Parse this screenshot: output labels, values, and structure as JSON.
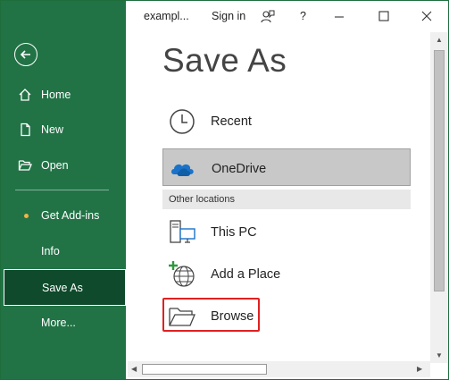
{
  "sidebar": {
    "back_icon": "back-arrow-icon",
    "items": [
      {
        "label": "Home",
        "icon": "home-icon"
      },
      {
        "label": "New",
        "icon": "new-document-icon"
      },
      {
        "label": "Open",
        "icon": "open-folder-icon"
      },
      {
        "label": "Get Add-ins",
        "icon": "dot-icon"
      },
      {
        "label": "Info"
      },
      {
        "label": "Save As",
        "selected": true
      },
      {
        "label": "More..."
      }
    ],
    "colors": {
      "background": "#217346",
      "selected": "#0e4a2b",
      "dot": "#f0b347"
    }
  },
  "titlebar": {
    "filename": "exampl...",
    "sign_in": "Sign in",
    "icons": [
      "people-help-icon",
      "help-icon",
      "minimize-icon",
      "maximize-icon",
      "close-icon"
    ],
    "help": "?"
  },
  "main": {
    "title": "Save As",
    "locations": [
      {
        "label": "Recent",
        "icon": "clock-icon"
      },
      {
        "label": "OneDrive",
        "icon": "onedrive-cloud-icon",
        "selected": true
      }
    ],
    "other_header": "Other locations",
    "other_locations": [
      {
        "label": "This PC",
        "icon": "computer-icon"
      },
      {
        "label": "Add a Place",
        "icon": "add-globe-icon"
      },
      {
        "label": "Browse",
        "icon": "folder-icon",
        "highlighted": true
      }
    ],
    "highlight_color": "#e02020"
  }
}
